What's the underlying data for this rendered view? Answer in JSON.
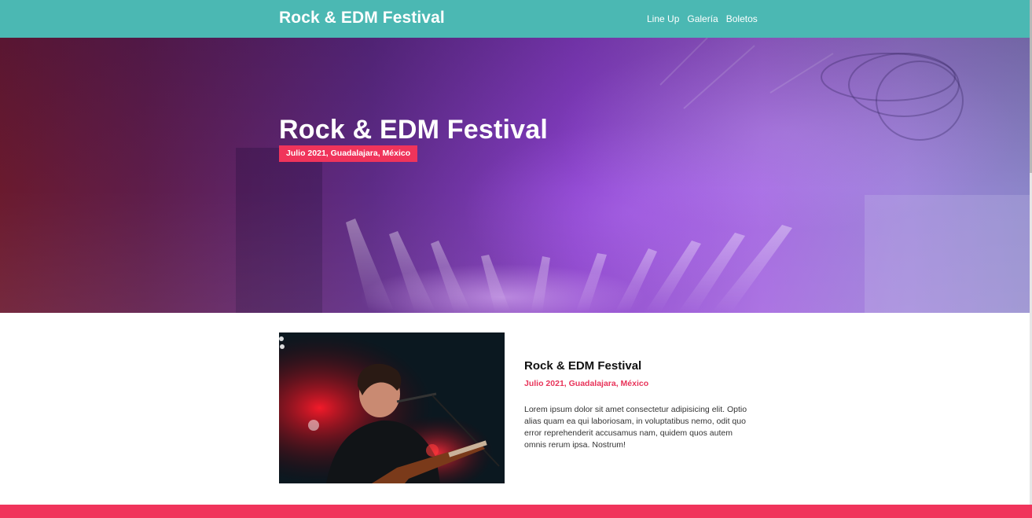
{
  "header": {
    "logo": "Rock & EDM Festival",
    "nav": [
      "Line Up",
      "Galería",
      "Boletos"
    ]
  },
  "hero": {
    "title": "Rock & EDM Festival",
    "subtitle": "Julio 2021, Guadalajara, México"
  },
  "event": {
    "title": "Rock & EDM Festival",
    "date": "Julio 2021, Guadalajara, México",
    "description": "Lorem ipsum dolor sit amet consectetur adipisicing elit. Optio alias quam ea qui laboriosam, in voluptatibus nemo, odit quo error reprehenderit accusamus nam, quidem quos autem omnis rerum ipsa. Nostrum!"
  },
  "colors": {
    "header_bg": "#4bb8b3",
    "accent": "#f0345b",
    "hero_purple": "#8840c9"
  }
}
